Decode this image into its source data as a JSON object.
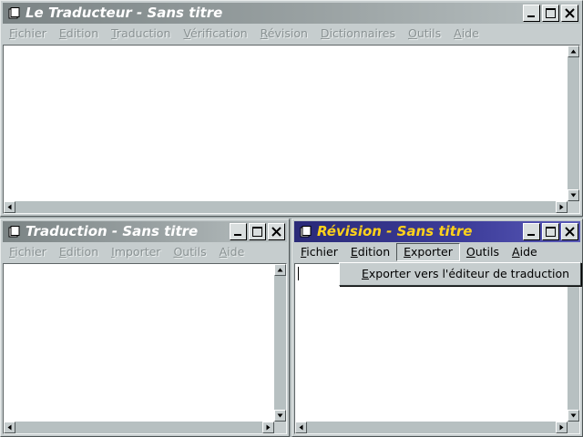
{
  "main_window": {
    "title": "Le Traducteur - Sans titre",
    "menu": [
      {
        "mn": "F",
        "rest": "ichier"
      },
      {
        "mn": "E",
        "rest": "dition"
      },
      {
        "mn": "T",
        "rest": "raduction"
      },
      {
        "mn": "V",
        "rest": "érification"
      },
      {
        "mn": "R",
        "rest": "évision"
      },
      {
        "mn": "D",
        "rest": "ictionnaires"
      },
      {
        "mn": "O",
        "rest": "utils"
      },
      {
        "mn": "A",
        "rest": "ide"
      }
    ]
  },
  "translation_window": {
    "title": "Traduction - Sans titre",
    "menu": [
      {
        "mn": "F",
        "rest": "ichier"
      },
      {
        "mn": "E",
        "rest": "dition"
      },
      {
        "mn": "I",
        "rest": "mporter"
      },
      {
        "mn": "O",
        "rest": "utils"
      },
      {
        "mn": "A",
        "rest": "ide"
      }
    ]
  },
  "revision_window": {
    "title": "Révision - Sans titre",
    "menu": [
      {
        "mn": "F",
        "rest": "ichier"
      },
      {
        "mn": "E",
        "rest": "dition"
      },
      {
        "mn": "E",
        "rest": "xporter"
      },
      {
        "mn": "O",
        "rest": "utils"
      },
      {
        "mn": "A",
        "rest": "ide"
      }
    ],
    "dropdown": {
      "pre": "",
      "mn": "E",
      "rest": "xporter vers l'éditeur de traduction"
    }
  },
  "colors": {
    "desktop": "#a9b2b3",
    "active_title": "#3d3d9a",
    "active_title_text": "#ffd21a",
    "inactive_title": "#8a9293"
  },
  "icons": [
    "window-menu-icon",
    "minimize-icon",
    "maximize-icon",
    "close-icon",
    "scroll-up-arrow-icon",
    "scroll-down-arrow-icon",
    "scroll-left-arrow-icon",
    "scroll-right-arrow-icon"
  ]
}
